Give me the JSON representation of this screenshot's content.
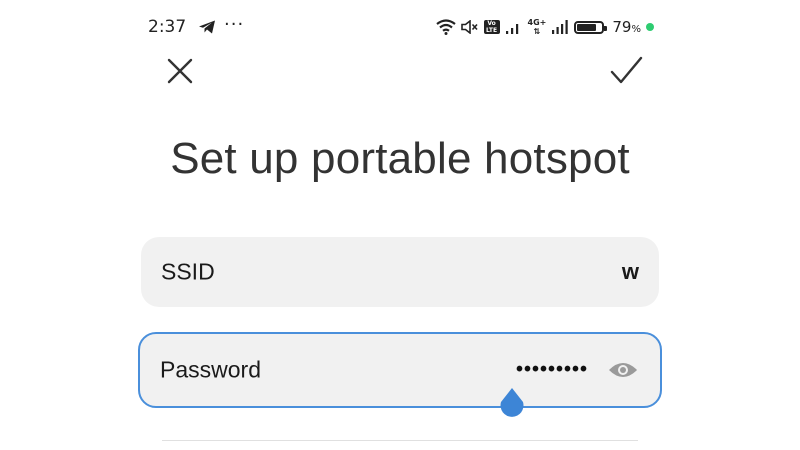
{
  "status_bar": {
    "time": "2:37",
    "overflow_indicator": "···",
    "volte_label": "Vo\nLTE",
    "network_label": "4G+",
    "battery_level": 0.79,
    "battery_percent": "79",
    "battery_unit": "%",
    "icons": [
      "telegram-icon",
      "wifi-icon",
      "mute-icon",
      "volte-icon",
      "signal-icon",
      "battery-icon"
    ],
    "accent_dot_color": "#2ecc71"
  },
  "toolbar": {
    "close_icon": "close-icon",
    "confirm_icon": "check-icon"
  },
  "page": {
    "title": "Set up portable hotspot"
  },
  "form": {
    "ssid": {
      "label": "SSID",
      "value": "w"
    },
    "password": {
      "label": "Password",
      "value": "•••••••••",
      "visibility_icon": "eye-icon"
    }
  },
  "colors": {
    "focus_border": "#4a8fdb",
    "field_background": "#f1f1f1",
    "cursor_handle": "#3d85d6"
  }
}
